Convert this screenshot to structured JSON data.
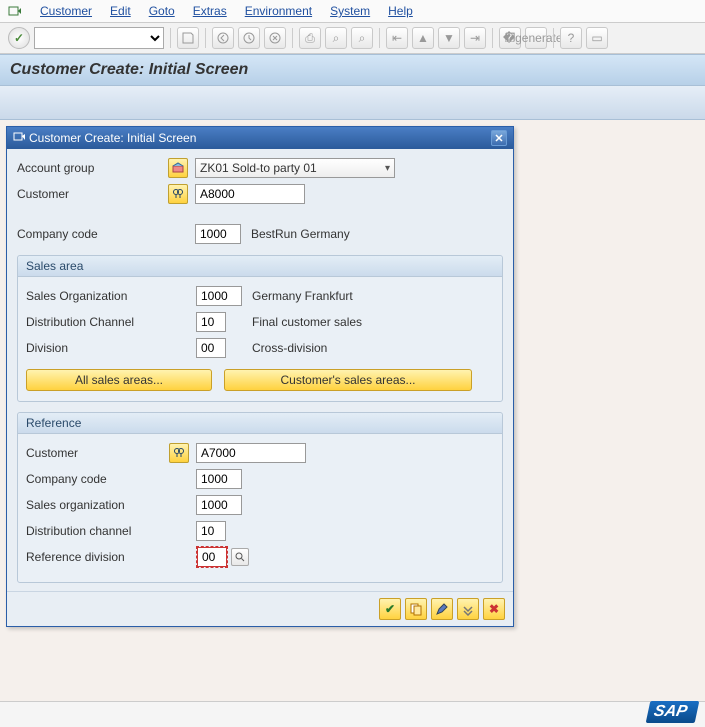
{
  "menu": {
    "items": [
      "Customer",
      "Edit",
      "Goto",
      "Extras",
      "Environment",
      "System",
      "Help"
    ]
  },
  "page_title": "Customer Create: Initial Screen",
  "modal": {
    "title": "Customer Create: Initial Screen",
    "account_group_label": "Account group",
    "account_group_value": "ZK01 Sold-to party 01",
    "customer_label": "Customer",
    "customer_value": "A8000",
    "company_code_label": "Company code",
    "company_code_value": "1000",
    "company_code_desc": "BestRun Germany",
    "sales_area": {
      "title": "Sales area",
      "sales_org_label": "Sales Organization",
      "sales_org_value": "1000",
      "sales_org_desc": "Germany Frankfurt",
      "dist_channel_label": "Distribution Channel",
      "dist_channel_value": "10",
      "dist_channel_desc": "Final customer sales",
      "division_label": "Division",
      "division_value": "00",
      "division_desc": "Cross-division",
      "btn_all": "All sales areas...",
      "btn_cust": "Customer's sales areas..."
    },
    "reference": {
      "title": "Reference",
      "customer_label": "Customer",
      "customer_value": "A7000",
      "company_code_label": "Company code",
      "company_code_value": "1000",
      "sales_org_label": "Sales organization",
      "sales_org_value": "1000",
      "dist_channel_label": "Distribution channel",
      "dist_channel_value": "10",
      "ref_div_label": "Reference division",
      "ref_div_value": "00"
    }
  },
  "logo": "SAP"
}
